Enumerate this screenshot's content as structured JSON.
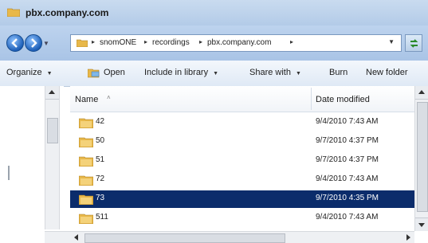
{
  "window": {
    "title": "pbx.company.com"
  },
  "address": {
    "crumbs": [
      "snomONE",
      "recordings",
      "pbx.company.com"
    ]
  },
  "toolbar": {
    "organize": "Organize",
    "open": "Open",
    "include_in_library": "Include in library",
    "share_with": "Share with",
    "burn": "Burn",
    "new_folder": "New folder"
  },
  "columns": {
    "name": "Name",
    "date_modified": "Date modified"
  },
  "files": [
    {
      "name": "42",
      "date": "9/4/2010 7:43 AM",
      "selected": false
    },
    {
      "name": "50",
      "date": "9/7/2010 4:37 PM",
      "selected": false
    },
    {
      "name": "51",
      "date": "9/7/2010 4:37 PM",
      "selected": false
    },
    {
      "name": "72",
      "date": "9/4/2010 7:43 AM",
      "selected": false
    },
    {
      "name": "73",
      "date": "9/7/2010 4:35 PM",
      "selected": true
    },
    {
      "name": "511",
      "date": "9/4/2010 7:43 AM",
      "selected": false
    }
  ],
  "colors": {
    "selection": "#0b2c6b",
    "folder": "#e8b84a"
  }
}
